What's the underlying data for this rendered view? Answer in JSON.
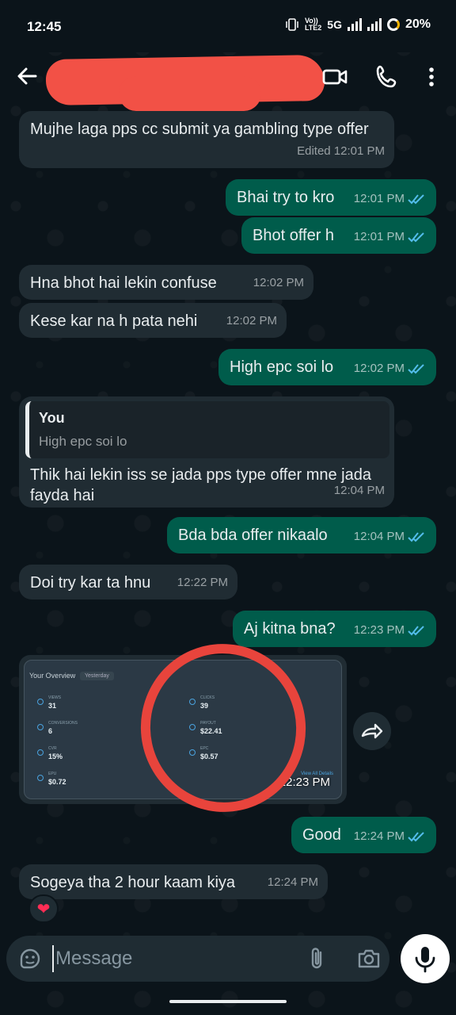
{
  "status_bar": {
    "time": "12:45",
    "network": "5G",
    "volte": "Vo))\nLTE2",
    "battery": "20%"
  },
  "header": {
    "contact_name": ""
  },
  "messages": [
    {
      "dir": "in",
      "text": "Mujhe laga pps cc submit ya gambling type offer",
      "meta": "Edited 12:01 PM"
    },
    {
      "dir": "out",
      "text": "Bhai try to kro",
      "meta": "12:01 PM"
    },
    {
      "dir": "out",
      "text": "Bhot offer h",
      "meta": "12:01 PM"
    },
    {
      "dir": "in",
      "text": "Hna bhot hai lekin confuse",
      "meta": "12:02 PM"
    },
    {
      "dir": "in",
      "text": "Kese kar na h pata nehi",
      "meta": "12:02 PM"
    },
    {
      "dir": "out",
      "text": "High epc soi lo",
      "meta": "12:02 PM"
    },
    {
      "dir": "in",
      "quote_name": "You",
      "quote_text": "High epc soi lo",
      "text": "Thik hai lekin iss se jada pps type offer mne jada fayda hai",
      "meta": "12:04 PM"
    },
    {
      "dir": "out",
      "text": "Bda bda offer nikaalo",
      "meta": "12:04 PM"
    },
    {
      "dir": "in",
      "text": "Doi try kar ta hnu",
      "meta": "12:22 PM"
    },
    {
      "dir": "out",
      "text": "Aj kitna bna?",
      "meta": "12:23 PM"
    },
    {
      "dir": "out",
      "text": "Good",
      "meta": "12:24 PM"
    },
    {
      "dir": "in",
      "text": "Sogeya tha 2 hour kaam kiya",
      "meta": "12:24 PM",
      "reaction": "❤"
    }
  ],
  "image_message": {
    "meta": "12:23 PM",
    "screenshot": {
      "title": "Your Overview",
      "period": "Yesterday",
      "stats": [
        {
          "label": "VIEWS",
          "value": "31"
        },
        {
          "label": "CLICKS",
          "value": "39"
        },
        {
          "label": "CONVERSIONS",
          "value": "6"
        },
        {
          "label": "PAYOUT",
          "value": "$22.41"
        },
        {
          "label": "CVR",
          "value": "15%"
        },
        {
          "label": "EPC",
          "value": "$0.57"
        },
        {
          "label": "EPU",
          "value": "$0.72"
        }
      ],
      "link": "View All Details"
    }
  },
  "input": {
    "placeholder": "Message"
  },
  "colors": {
    "background": "#0b141a",
    "incoming": "#202c33",
    "outgoing": "#005c4b",
    "read_ticks": "#53bdeb",
    "annotation_circle": "#e8443c"
  }
}
